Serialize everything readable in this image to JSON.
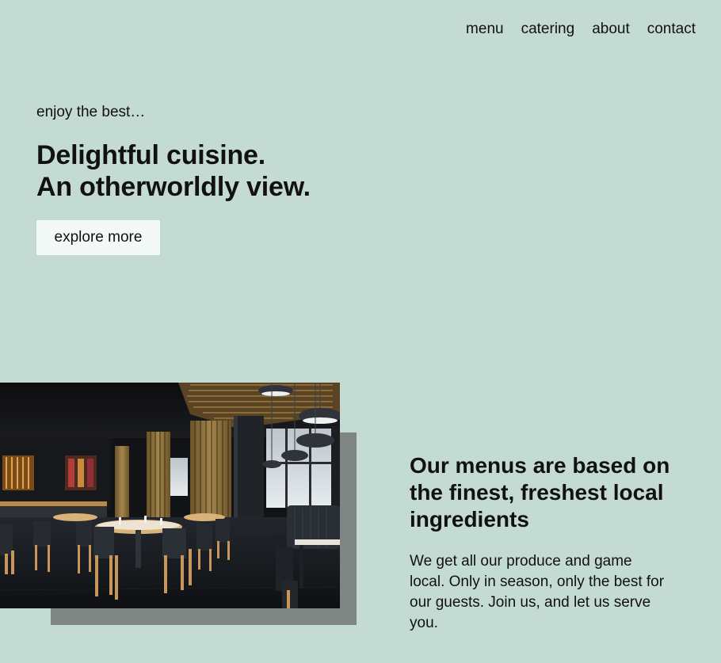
{
  "nav": {
    "items": [
      "menu",
      "catering",
      "about",
      "contact"
    ]
  },
  "hero": {
    "eyebrow": "enjoy the best…",
    "title_line1": "Delightful cuisine.",
    "title_line2": "An otherworldly view.",
    "cta_label": "explore more"
  },
  "feature": {
    "heading": "Our menus are based on the finest, freshest local ingredients",
    "body": "We get all our produce and game local. Only in season, only the best for our guests. Join us, and let us serve you."
  },
  "colors": {
    "background": "#c4dbd4",
    "button_bg": "#f2f9f7",
    "photo_shadow": "#7f8583",
    "text": "#111111"
  }
}
